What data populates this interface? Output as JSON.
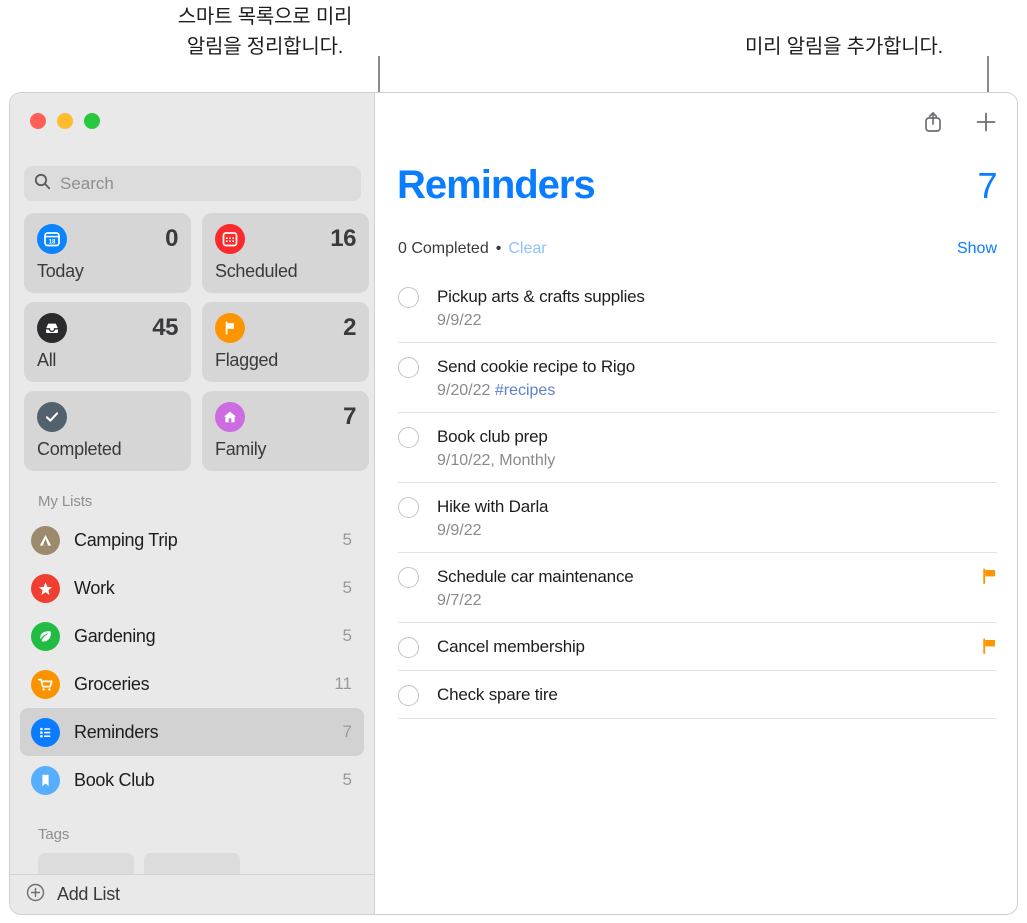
{
  "callouts": {
    "left": "스마트 목록으로 미리\n알림을 정리합니다.",
    "right": "미리 알림을 추가합니다."
  },
  "sidebar": {
    "search": {
      "placeholder": "Search",
      "value": "",
      "icon": "search-icon"
    },
    "traffic_lights": [
      {
        "name": "close",
        "color": "#ff5f57"
      },
      {
        "name": "minimize",
        "color": "#febc2e"
      },
      {
        "name": "zoom",
        "color": "#28c840"
      }
    ],
    "smart_cards": [
      {
        "label": "Today",
        "count": "0",
        "icon": "calendar-day-icon",
        "color": "#0a84ff"
      },
      {
        "label": "Scheduled",
        "count": "16",
        "icon": "calendar-icon",
        "color": "#fc2b2b"
      },
      {
        "label": "All",
        "count": "45",
        "icon": "tray-icon",
        "color": "#2b2b2e"
      },
      {
        "label": "Flagged",
        "count": "2",
        "icon": "flag-icon",
        "color": "#fd9500"
      },
      {
        "label": "Completed",
        "count": "",
        "icon": "checkmark-icon",
        "color": "#52616b"
      },
      {
        "label": "Family",
        "count": "7",
        "icon": "house-icon",
        "color": "#cd6ce0"
      }
    ],
    "my_lists_header": "My Lists",
    "lists": [
      {
        "label": "Camping Trip",
        "count": "5",
        "icon": "tent-icon",
        "color": "#9b8a6b",
        "selected": false
      },
      {
        "label": "Work",
        "count": "5",
        "icon": "star-icon",
        "color": "#f03e30",
        "selected": false
      },
      {
        "label": "Gardening",
        "count": "5",
        "icon": "leaf-icon",
        "color": "#22bb44",
        "selected": false
      },
      {
        "label": "Groceries",
        "count": "11",
        "icon": "cart-icon",
        "color": "#f99400",
        "selected": false
      },
      {
        "label": "Reminders",
        "count": "7",
        "icon": "list-bullet-icon",
        "color": "#0a7cff",
        "selected": true
      },
      {
        "label": "Book Club",
        "count": "5",
        "icon": "bookmark-icon",
        "color": "#57aeff",
        "selected": false
      }
    ],
    "tags_header": "Tags",
    "add_list": {
      "label": "Add List",
      "icon": "plus-circle-icon"
    }
  },
  "main": {
    "toolbar": [
      {
        "name": "share-icon",
        "label": "Share"
      },
      {
        "name": "plus-icon",
        "label": "Add Reminder"
      }
    ],
    "title": "Reminders",
    "total": "7",
    "completed_text": "0 Completed",
    "separator": "•",
    "clear_label": "Clear",
    "show_label": "Show",
    "accent_color": "#0a7cff",
    "reminders": [
      {
        "title": "Pickup arts & crafts supplies",
        "date": "9/9/22",
        "tag": "",
        "flagged": false
      },
      {
        "title": "Send cookie recipe to Rigo",
        "date": "9/20/22",
        "tag": "#recipes",
        "flagged": false
      },
      {
        "title": "Book club prep",
        "date": "9/10/22, Monthly",
        "tag": "",
        "flagged": false
      },
      {
        "title": "Hike with Darla",
        "date": "9/9/22",
        "tag": "",
        "flagged": false
      },
      {
        "title": "Schedule car maintenance",
        "date": "9/7/22",
        "tag": "",
        "flagged": true
      },
      {
        "title": "Cancel membership",
        "date": "",
        "tag": "",
        "flagged": true
      },
      {
        "title": "Check spare tire",
        "date": "",
        "tag": "",
        "flagged": false
      }
    ]
  }
}
